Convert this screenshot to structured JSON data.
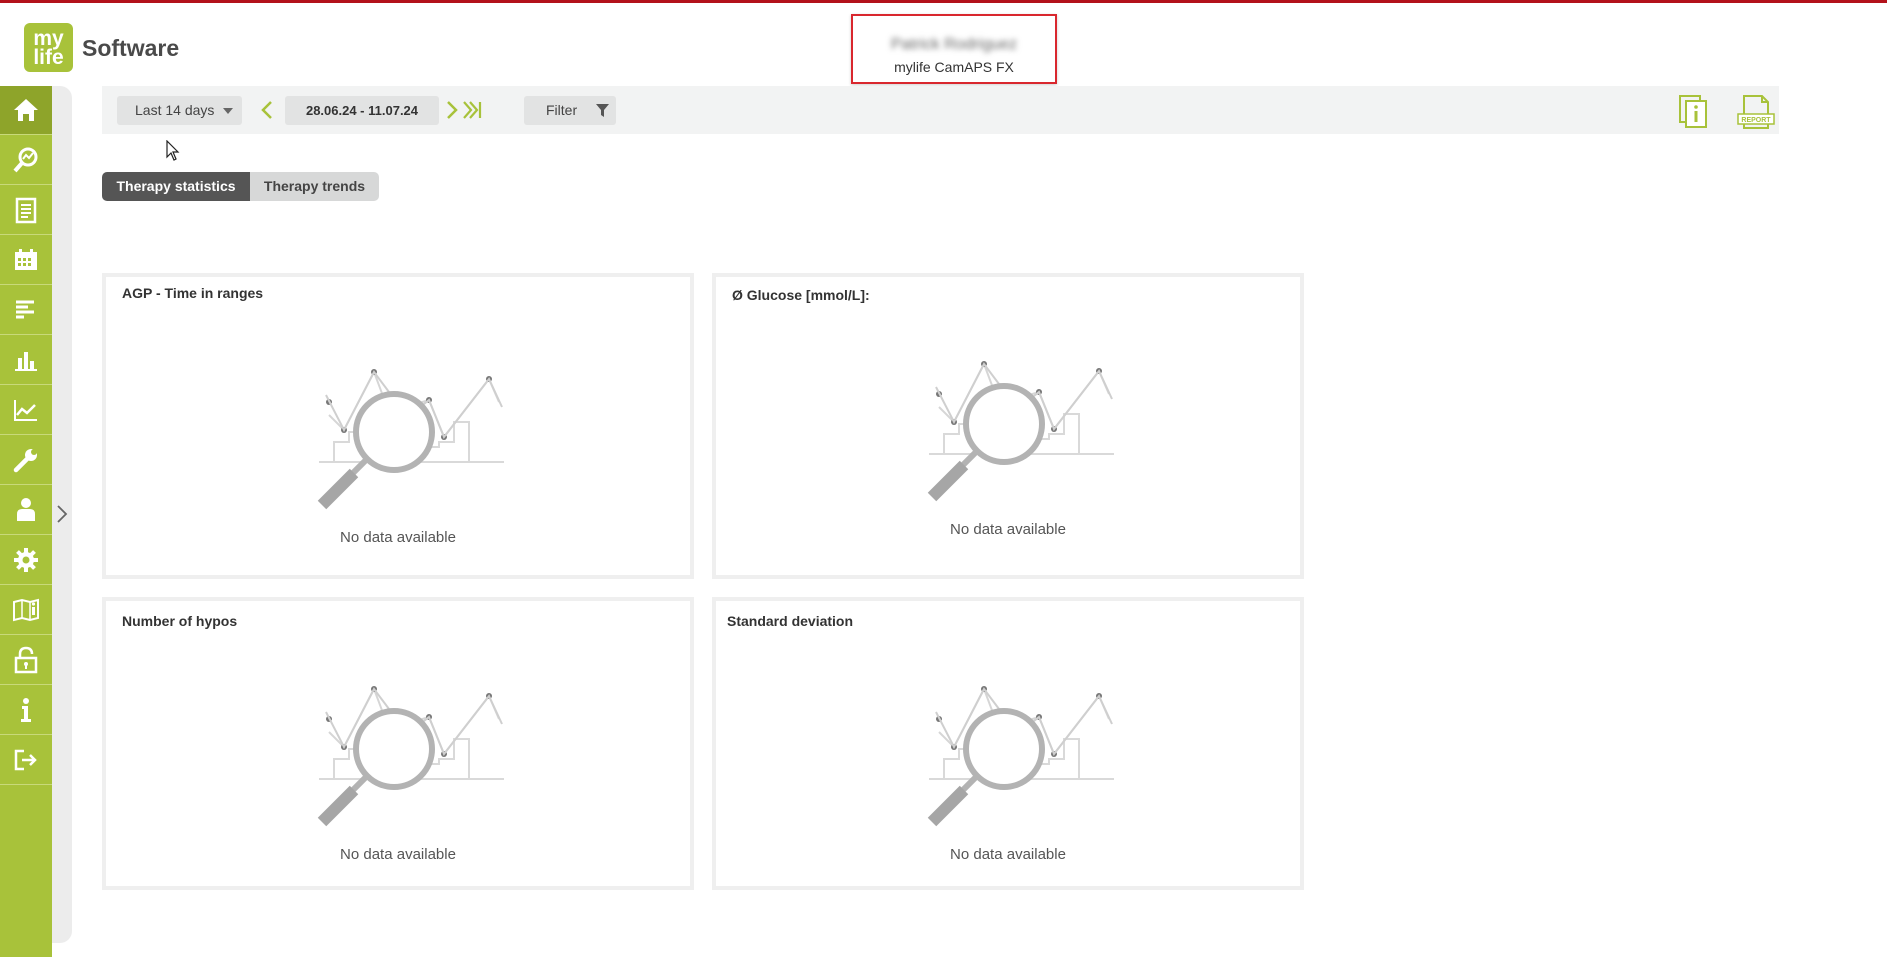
{
  "header": {
    "logo_line1": "my",
    "logo_line2": "life",
    "brand": "Software",
    "patient_name": "Patrick Rodriguez",
    "device": "mylife CamAPS FX"
  },
  "sidebar": {
    "items": [
      {
        "icon": "home-icon"
      },
      {
        "icon": "analysis-icon"
      },
      {
        "icon": "logbook-icon"
      },
      {
        "icon": "calendar-icon"
      },
      {
        "icon": "list-icon"
      },
      {
        "icon": "bar-chart-icon"
      },
      {
        "icon": "line-chart-icon"
      },
      {
        "icon": "wrench-icon"
      },
      {
        "icon": "patient-icon"
      },
      {
        "icon": "gear-icon"
      },
      {
        "icon": "manual-icon"
      },
      {
        "icon": "unlock-icon"
      },
      {
        "icon": "info-icon"
      },
      {
        "icon": "logout-icon"
      }
    ]
  },
  "toolbar": {
    "range": "Last 14 days",
    "dates": "28.06.24 - 11.07.24",
    "filter": "Filter"
  },
  "tabs": {
    "statistics": "Therapy statistics",
    "trends": "Therapy trends"
  },
  "cards": {
    "agp": {
      "title": "AGP - Time in ranges",
      "empty": "No data available"
    },
    "glucose": {
      "title": "Ø Glucose [mmol/L]:",
      "empty": "No data available"
    },
    "hypos": {
      "title": "Number of hypos",
      "empty": "No data available"
    },
    "stddev": {
      "title": "Standard deviation",
      "empty": "No data available"
    }
  },
  "colors": {
    "brand_green": "#a8c23a",
    "highlight_red": "#d9272e"
  }
}
